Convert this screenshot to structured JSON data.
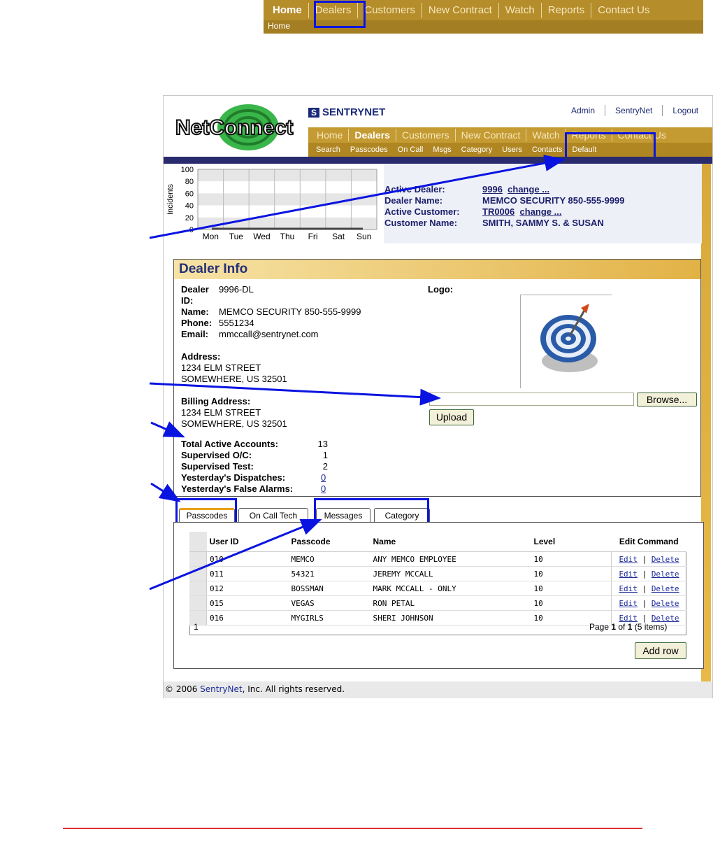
{
  "top_nav": {
    "items": [
      "Home",
      "Dealers",
      "Customers",
      "New Contract",
      "Watch",
      "Reports",
      "Contact Us"
    ],
    "breadcrumb": "Home"
  },
  "header": {
    "logo_text": "NetConnect",
    "brand": "SENTRYNET",
    "admin_links": [
      "Admin",
      "SentryNet",
      "Logout"
    ]
  },
  "main_nav": {
    "items": [
      "Home",
      "Dealers",
      "Customers",
      "New Contract",
      "Watch",
      "Reports",
      "Contact Us"
    ],
    "sub_items": [
      "Search",
      "Passcodes",
      "On Call",
      "Msgs",
      "Category",
      "Users",
      "Contacts",
      "Default"
    ]
  },
  "chart_data": {
    "type": "line",
    "categories": [
      "Mon",
      "Tue",
      "Wed",
      "Thu",
      "Fri",
      "Sat",
      "Sun"
    ],
    "values": [
      0,
      0,
      0,
      0,
      0,
      0,
      0
    ],
    "ylabel": "Incidents",
    "yticks": [
      "100",
      "80",
      "60",
      "40",
      "20",
      "0"
    ],
    "ylim": [
      0,
      100
    ],
    "grid": true
  },
  "summary": {
    "active_dealer_label": "Active Dealer:",
    "active_dealer": "9996",
    "change_label": "change ...",
    "dealer_name_label": "Dealer Name:",
    "dealer_name": "MEMCO SECURITY 850-555-9999",
    "active_customer_label": "Active Customer:",
    "active_customer": "TR0006",
    "customer_name_label": "Customer Name:",
    "customer_name": "SMITH, SAMMY S. & SUSAN"
  },
  "dealer_info": {
    "title": "Dealer Info",
    "dealer_id_label": "Dealer ID:",
    "dealer_id": "9996-DL",
    "name_label": "Name:",
    "name": "MEMCO SECURITY 850-555-9999",
    "phone_label": "Phone:",
    "phone": "5551234",
    "email_label": "Email:",
    "email": "mmccall@sentrynet.com",
    "address_label": "Address:",
    "address1": "1234 ELM STREET",
    "address2": "SOMEWHERE, US 32501",
    "billing_label": "Billing Address:",
    "billing1": "1234 ELM STREET",
    "billing2": "SOMEWHERE, US 32501",
    "logo_label": "Logo:",
    "browse_label": "Browse...",
    "upload_label": "Upload",
    "stats": [
      {
        "label": "Total Active Accounts:",
        "value": "13"
      },
      {
        "label": "Supervised O/C:",
        "value": "1"
      },
      {
        "label": "Supervised Test:",
        "value": "2"
      },
      {
        "label": "Yesterday's Dispatches:",
        "value": "0"
      },
      {
        "label": "Yesterday's False Alarms:",
        "value": "0"
      }
    ]
  },
  "tabs": [
    "Passcodes",
    "On Call Tech",
    "Messages",
    "Category"
  ],
  "grid": {
    "columns": [
      "User ID",
      "Passcode",
      "Name",
      "Level",
      "Edit Command"
    ],
    "rows": [
      [
        "010",
        "MEMCO",
        "ANY MEMCO EMPLOYEE",
        "10"
      ],
      [
        "011",
        "54321",
        "JEREMY MCCALL",
        "10"
      ],
      [
        "012",
        "BOSSMAN",
        "MARK MCCALL - ONLY",
        "10"
      ],
      [
        "015",
        "VEGAS",
        "RON PETAL",
        "10"
      ],
      [
        "016",
        "MYGIRLS",
        "SHERI JOHNSON",
        "10"
      ]
    ],
    "edit_label": "Edit",
    "delete_label": "Delete",
    "separator": "|",
    "pager_left": "1",
    "pager_text_prefix": "Page ",
    "pager_page": "1",
    "pager_of": " of ",
    "pager_total": "1",
    "pager_items": " (5 items)",
    "add_row_label": "Add row"
  },
  "footer": {
    "prefix": "© 2006 ",
    "link": "SentryNet",
    "suffix": ", Inc. All rights reserved."
  }
}
